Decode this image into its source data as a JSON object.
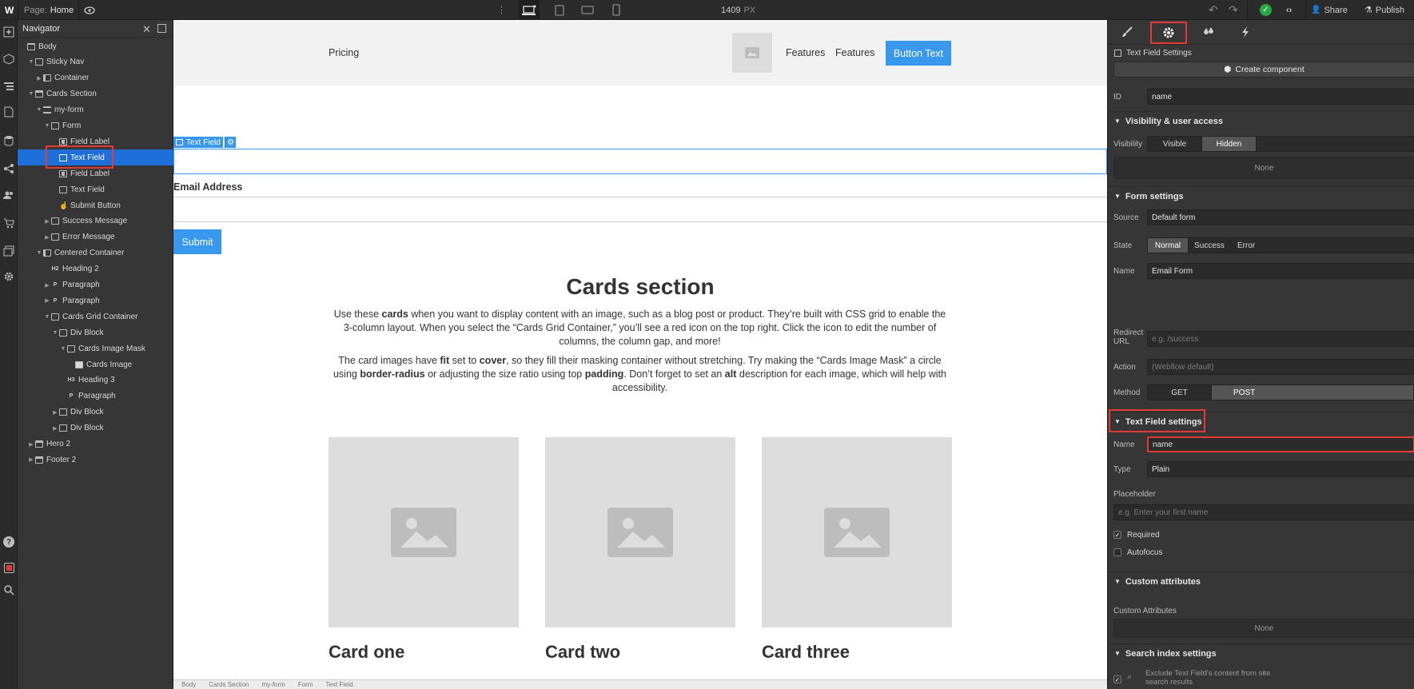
{
  "topbar": {
    "page_label": "Page:",
    "page_name": "Home",
    "width_value": "1409",
    "width_unit": "PX",
    "share_label": "Share",
    "publish_label": "Publish",
    "accent": "#3898ec"
  },
  "navigator": {
    "title": "Navigator",
    "items": [
      {
        "label": "Body"
      },
      {
        "label": "Sticky Nav"
      },
      {
        "label": "Container"
      },
      {
        "label": "Cards Section"
      },
      {
        "label": "my-form"
      },
      {
        "label": "Form"
      },
      {
        "label": "Field Label"
      },
      {
        "label": "Text Field"
      },
      {
        "label": "Field Label"
      },
      {
        "label": "Text Field"
      },
      {
        "label": "Submit Button"
      },
      {
        "label": "Success Message"
      },
      {
        "label": "Error Message"
      },
      {
        "label": "Centered Container"
      },
      {
        "label": "Heading 2",
        "tag": "H2"
      },
      {
        "label": "Paragraph",
        "tag": "P"
      },
      {
        "label": "Paragraph",
        "tag": "P"
      },
      {
        "label": "Cards Grid Container"
      },
      {
        "label": "Div Block"
      },
      {
        "label": "Cards Image Mask"
      },
      {
        "label": "Cards Image"
      },
      {
        "label": "Heading 3",
        "tag": "H3"
      },
      {
        "label": "Paragraph",
        "tag": "P"
      },
      {
        "label": "Div Block"
      },
      {
        "label": "Div Block"
      },
      {
        "label": "Hero 2"
      },
      {
        "label": "Footer 2"
      }
    ]
  },
  "canvas": {
    "nav": {
      "pricing": "Pricing",
      "features_1": "Features",
      "features_2": "Features",
      "button": "Button Text"
    },
    "selected_tag": "Text Field",
    "email_label": "Email Address",
    "submit": "Submit",
    "cards_heading": "Cards section",
    "para1": {
      "t1": "Use these ",
      "b1": "cards",
      "t2": " when you want to display content with an image, such as a blog post or product. They’re built with CSS grid to enable the 3-column layout. When you select the “Cards Grid Container,” you’ll see a red icon on the top right. Click the icon to edit the number of columns, the column gap, and more!"
    },
    "para2": {
      "t1": "The card images have ",
      "b1": "fit",
      "t2": " set to ",
      "b2": "cover",
      "t3": ", so they fill their masking container without stretching. Try making the “Cards Image Mask” a circle using ",
      "b3": "border-radius",
      "t4": " or adjusting the size ratio using top ",
      "b4": "padding",
      "t5": ". Don’t forget to set an ",
      "b5": "alt",
      "t6": " description for each image, which will help with accessibility."
    },
    "cards": [
      "Card one",
      "Card two",
      "Card three"
    ]
  },
  "settings": {
    "header": "Text Field Settings",
    "create_component": "Create component",
    "id_label": "ID",
    "id_value": "name",
    "visibility_section": "Visibility & user access",
    "visibility_label": "Visibility",
    "visible": "Visible",
    "hidden": "Hidden",
    "none1": "None",
    "form_section": "Form settings",
    "source_label": "Source",
    "source_value": "Default form",
    "state_label": "State",
    "state_normal": "Normal",
    "state_success": "Success",
    "state_error": "Error",
    "name_label": "Name",
    "form_name": "Email Form",
    "redirect_label": "Redirect URL",
    "redirect_placeholder": "e.g. /success",
    "action_label": "Action",
    "action_placeholder": "(Webflow default)",
    "method_label": "Method",
    "get": "GET",
    "post": "POST",
    "tf_section": "Text Field settings",
    "tf_name_label": "Name",
    "tf_name_value": "name",
    "type_label": "Type",
    "type_value": "Plain",
    "placeholder_label": "Placeholder",
    "placeholder_hint": "e.g. Enter your first name",
    "required": "Required",
    "autofocus": "Autofocus",
    "custom_section": "Custom attributes",
    "custom_label": "Custom Attributes",
    "none2": "None",
    "search_section": "Search index settings",
    "exclude_text": "Exclude Text Field's content from site search results"
  },
  "breadcrumbs": [
    "Body",
    "Cards Section",
    "my-form",
    "Form",
    "Text Field"
  ]
}
